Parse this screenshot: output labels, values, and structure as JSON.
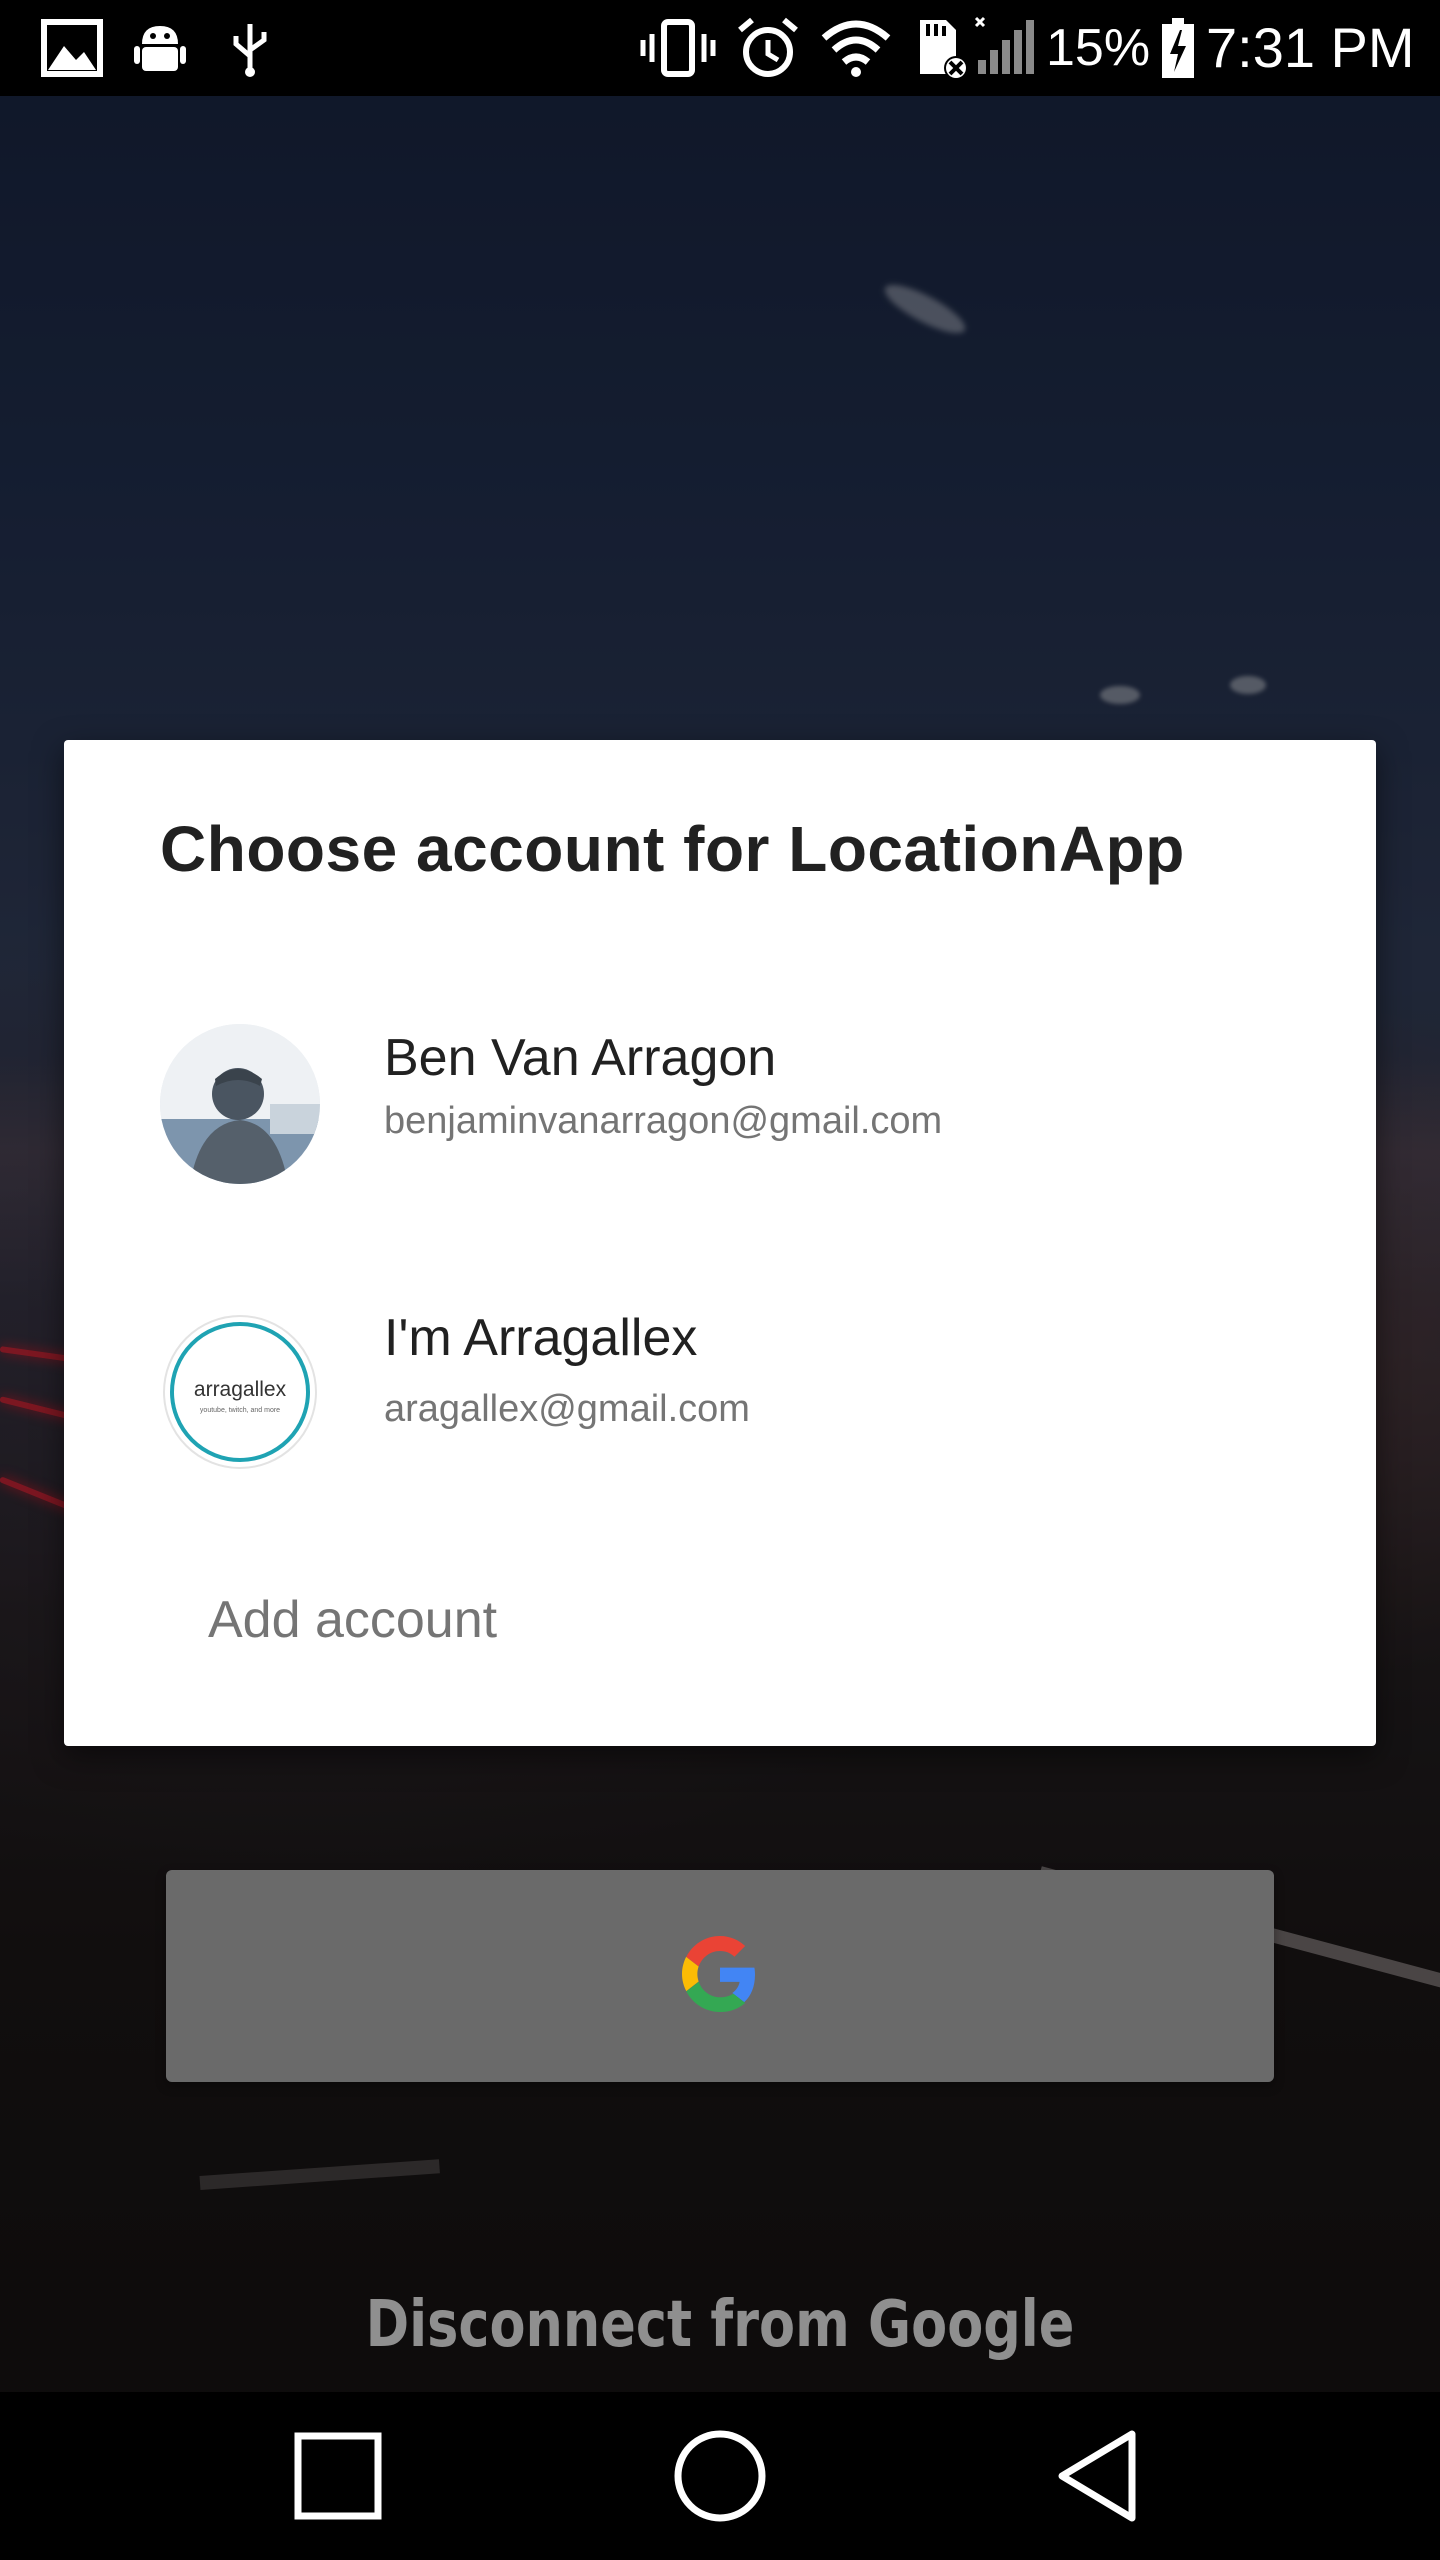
{
  "status_bar": {
    "battery_percent": "15%",
    "time": "7:31 PM",
    "icons": [
      "gallery-icon",
      "android-debug-icon",
      "usb-icon",
      "vibrate-icon",
      "alarm-icon",
      "wifi-icon",
      "sd-card-icon",
      "signal-icon",
      "battery-charging-icon"
    ]
  },
  "dialog": {
    "title": "Choose account for LocationApp",
    "accounts": [
      {
        "name": "Ben Van Arragon",
        "email": "benjaminvanarragon@gmail.com",
        "avatar": "photo"
      },
      {
        "name": "I'm Arragallex",
        "email": "aragallex@gmail.com",
        "avatar": "logo",
        "logo_text": "arragallex",
        "logo_subtext": "youtube, twitch, and more"
      }
    ],
    "add_account_label": "Add account"
  },
  "background_app": {
    "disconnect_label": "Disconnect from Google",
    "google_button_icon": "google-g-icon"
  },
  "colors": {
    "dialog_bg": "#ffffff",
    "title_text": "#212121",
    "secondary_text": "#757575",
    "logo_ring": "#1fa3b3",
    "google_blue": "#4285F4",
    "google_red": "#EA4335",
    "google_yellow": "#FBBC05",
    "google_green": "#34A853"
  },
  "nav_bar": {
    "buttons": [
      "recents-button",
      "home-button",
      "back-button"
    ]
  }
}
